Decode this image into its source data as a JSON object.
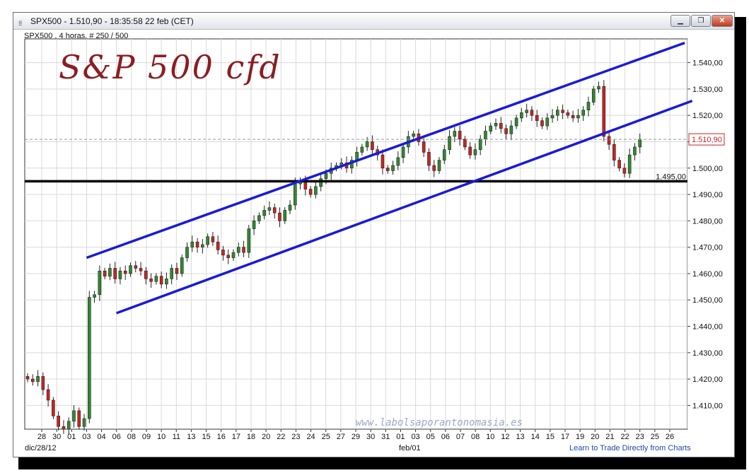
{
  "window": {
    "title": "SPX500 - 1.510,90 - 18:35:58  22 feb (CET)",
    "subtitle": "SPX500 , 4 horas, # 250 / 500"
  },
  "annotation_title": "S&P 500 cfd",
  "watermark": "www.labolsaporantonomasia.es",
  "footer": {
    "start_date": "dic/28/12",
    "mid_date": "feb/01",
    "link": "Learn to Trade Directly from Charts"
  },
  "chart_data": {
    "type": "candlestick",
    "title": "",
    "xlabel": "",
    "ylabel": "",
    "ylim": [
      1401,
      1549
    ],
    "grid": true,
    "y_ticks": [
      "1.540,00",
      "1.530,00",
      "1.520,00",
      "1.510,00",
      "1.500,00",
      "1.490,00",
      "1.480,00",
      "1.470,00",
      "1.460,00",
      "1.450,00",
      "1.440,00",
      "1.430,00",
      "1.420,00",
      "1.410,00"
    ],
    "y_tick_values": [
      1540,
      1530,
      1520,
      1510,
      1500,
      1490,
      1480,
      1470,
      1460,
      1450,
      1440,
      1430,
      1420,
      1410
    ],
    "x_ticks": [
      "28",
      "30",
      "01",
      "03",
      "04",
      "06",
      "08",
      "09",
      "10",
      "11",
      "13",
      "15",
      "16",
      "17",
      "18",
      "20",
      "22",
      "23",
      "24",
      "25",
      "27",
      "29",
      "30",
      "31",
      "01",
      "03",
      "05",
      "06",
      "07",
      "08",
      "10",
      "12",
      "13",
      "14",
      "15",
      "17",
      "19",
      "20",
      "21",
      "22",
      "23",
      "25",
      "26"
    ],
    "last_price_label": "1.510,90",
    "last_price": 1510.9,
    "support_level": 1495.0,
    "support_label": "1.495,00",
    "up_color": "#2e8b2e",
    "down_color": "#cc2222",
    "channel_color": "#1a1ad8",
    "support_color": "#000000",
    "channel_lines": [
      {
        "from": [
          3,
          1466
        ],
        "to": [
          43,
          1547.5
        ]
      },
      {
        "from": [
          5,
          1445
        ],
        "to": [
          43.5,
          1525.5
        ]
      },
      {
        "from": [
          3,
          1466
        ],
        "to": [
          5,
          1445
        ]
      }
    ],
    "closes": [
      1420,
      1419,
      1421,
      1416,
      1412,
      1406,
      1402,
      1401,
      1404,
      1408,
      1402,
      1405,
      1451,
      1452,
      1461,
      1459,
      1462,
      1458,
      1461,
      1460,
      1463,
      1462,
      1461,
      1458,
      1457,
      1459,
      1456,
      1458,
      1462,
      1460,
      1466,
      1470,
      1472,
      1470,
      1471,
      1474,
      1472,
      1469,
      1467,
      1466,
      1468,
      1470,
      1468,
      1477,
      1480,
      1482,
      1484,
      1485,
      1483,
      1480,
      1484,
      1486,
      1494,
      1495,
      1492,
      1490,
      1493,
      1496,
      1498,
      1500,
      1501,
      1502,
      1500,
      1503,
      1506,
      1508,
      1510,
      1507,
      1505,
      1500,
      1499,
      1501,
      1504,
      1508,
      1512,
      1513,
      1510,
      1506,
      1501,
      1499,
      1503,
      1507,
      1512,
      1514,
      1511,
      1508,
      1505,
      1507,
      1511,
      1514,
      1516,
      1517,
      1515,
      1513,
      1516,
      1519,
      1521,
      1522,
      1520,
      1518,
      1516,
      1519,
      1520,
      1522,
      1521,
      1520,
      1519,
      1520,
      1522,
      1525,
      1530,
      1531,
      1512,
      1509,
      1503,
      1500,
      1498,
      1505,
      1508,
      1511
    ]
  }
}
